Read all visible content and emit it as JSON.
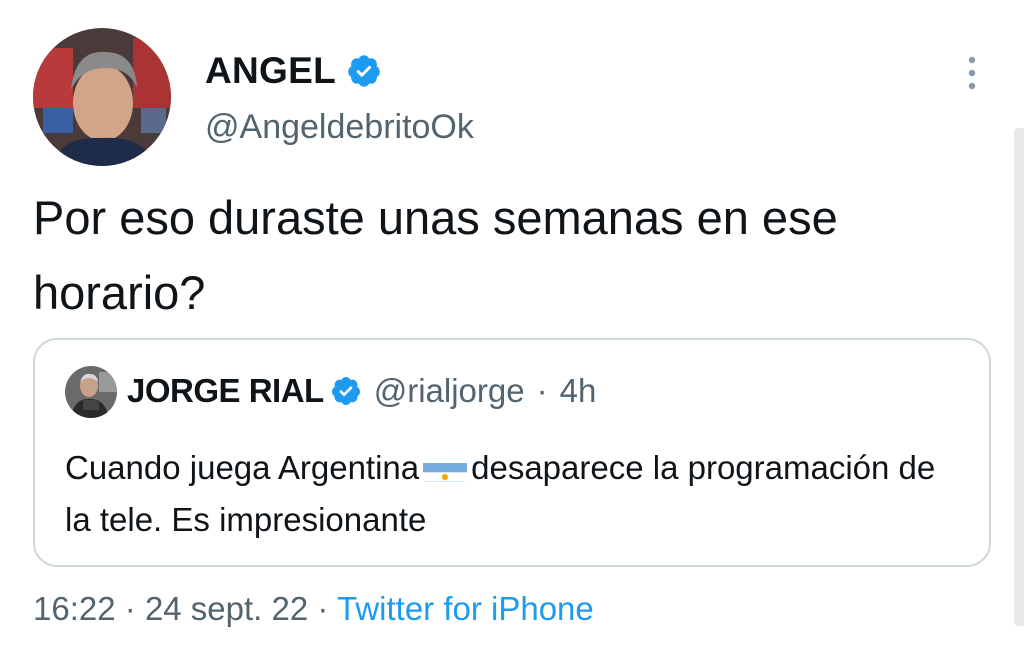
{
  "tweet": {
    "display_name": "ANGEL",
    "handle": "@AngeldebritoOk",
    "text": "Por eso duraste unas semanas en ese horario?",
    "time": "16:22",
    "separator": "·",
    "date": "24 sept. 22",
    "source": "Twitter for iPhone"
  },
  "quote": {
    "display_name": "JORGE RIAL",
    "handle": "@rialjorge",
    "separator": "·",
    "age": "4h",
    "text_before_flag": "Cuando juega Argentina",
    "text_after_flag": "desaparece la programación de la tele. Es impresionante"
  },
  "icons": {
    "verified": "verified-badge-icon",
    "more": "more-options-icon",
    "flag": "argentina-flag-emoji"
  },
  "colors": {
    "text": "#0f1419",
    "secondary": "#536471",
    "link": "#1d9bf0",
    "verified": "#1d9bf0",
    "border": "#cfd9de"
  }
}
